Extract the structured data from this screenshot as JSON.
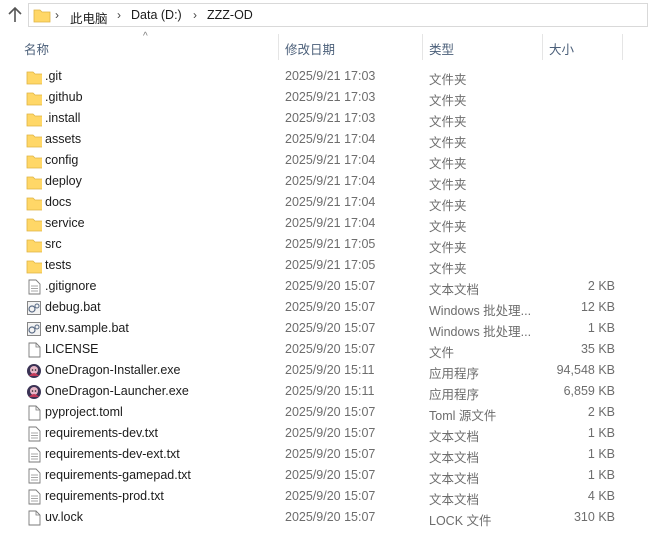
{
  "address_bar": {
    "crumbs": [
      "此电脑",
      "Data (D:)",
      "ZZZ-OD"
    ]
  },
  "columns": {
    "name": "名称",
    "modified": "修改日期",
    "type": "类型",
    "size": "大小"
  },
  "files": [
    {
      "name": ".git",
      "modified": "2025/9/21 17:03",
      "type": "文件夹",
      "size": "",
      "icon": "folder-icon"
    },
    {
      "name": ".github",
      "modified": "2025/9/21 17:03",
      "type": "文件夹",
      "size": "",
      "icon": "folder-icon"
    },
    {
      "name": ".install",
      "modified": "2025/9/21 17:03",
      "type": "文件夹",
      "size": "",
      "icon": "folder-icon"
    },
    {
      "name": "assets",
      "modified": "2025/9/21 17:04",
      "type": "文件夹",
      "size": "",
      "icon": "folder-icon"
    },
    {
      "name": "config",
      "modified": "2025/9/21 17:04",
      "type": "文件夹",
      "size": "",
      "icon": "folder-icon"
    },
    {
      "name": "deploy",
      "modified": "2025/9/21 17:04",
      "type": "文件夹",
      "size": "",
      "icon": "folder-icon"
    },
    {
      "name": "docs",
      "modified": "2025/9/21 17:04",
      "type": "文件夹",
      "size": "",
      "icon": "folder-icon"
    },
    {
      "name": "service",
      "modified": "2025/9/21 17:04",
      "type": "文件夹",
      "size": "",
      "icon": "folder-icon"
    },
    {
      "name": "src",
      "modified": "2025/9/21 17:05",
      "type": "文件夹",
      "size": "",
      "icon": "folder-icon"
    },
    {
      "name": "tests",
      "modified": "2025/9/21 17:05",
      "type": "文件夹",
      "size": "",
      "icon": "folder-icon"
    },
    {
      "name": ".gitignore",
      "modified": "2025/9/20 15:07",
      "type": "文本文档",
      "size": "2 KB",
      "icon": "text-file-icon"
    },
    {
      "name": "debug.bat",
      "modified": "2025/9/20 15:07",
      "type": "Windows 批处理...",
      "size": "12 KB",
      "icon": "batch-file-icon"
    },
    {
      "name": "env.sample.bat",
      "modified": "2025/9/20 15:07",
      "type": "Windows 批处理...",
      "size": "1 KB",
      "icon": "batch-file-icon"
    },
    {
      "name": "LICENSE",
      "modified": "2025/9/20 15:07",
      "type": "文件",
      "size": "35 KB",
      "icon": "blank-file-icon"
    },
    {
      "name": "OneDragon-Installer.exe",
      "modified": "2025/9/20 15:11",
      "type": "应用程序",
      "size": "94,548 KB",
      "icon": "app-icon"
    },
    {
      "name": "OneDragon-Launcher.exe",
      "modified": "2025/9/20 15:11",
      "type": "应用程序",
      "size": "6,859 KB",
      "icon": "app-icon"
    },
    {
      "name": "pyproject.toml",
      "modified": "2025/9/20 15:07",
      "type": "Toml 源文件",
      "size": "2 KB",
      "icon": "blank-file-icon"
    },
    {
      "name": "requirements-dev.txt",
      "modified": "2025/9/20 15:07",
      "type": "文本文档",
      "size": "1 KB",
      "icon": "text-file-icon"
    },
    {
      "name": "requirements-dev-ext.txt",
      "modified": "2025/9/20 15:07",
      "type": "文本文档",
      "size": "1 KB",
      "icon": "text-file-icon"
    },
    {
      "name": "requirements-gamepad.txt",
      "modified": "2025/9/20 15:07",
      "type": "文本文档",
      "size": "1 KB",
      "icon": "text-file-icon"
    },
    {
      "name": "requirements-prod.txt",
      "modified": "2025/9/20 15:07",
      "type": "文本文档",
      "size": "4 KB",
      "icon": "text-file-icon"
    },
    {
      "name": "uv.lock",
      "modified": "2025/9/20 15:07",
      "type": "LOCK 文件",
      "size": "310 KB",
      "icon": "blank-file-icon"
    }
  ]
}
